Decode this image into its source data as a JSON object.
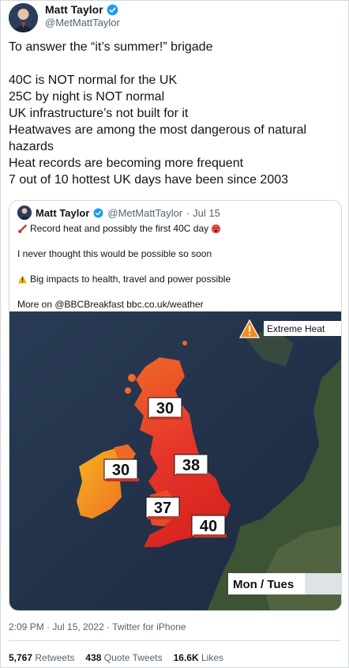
{
  "author": {
    "name": "Matt Taylor",
    "handle": "@MetMattTaylor"
  },
  "tweet": {
    "lines": [
      "To answer the “it’s summer!” brigade",
      "40C is NOT normal for the UK",
      "25C by night is NOT normal",
      "UK infrastructure’s not built for it",
      "Heatwaves are among the most dangerous of natural",
      "hazards",
      "Heat records are becoming more frequent",
      "7 out of 10 hottest UK days have been since 2003"
    ]
  },
  "quote": {
    "name": "Matt Taylor",
    "handle": "@MetMattTaylor",
    "date": "· Jul 15",
    "line1": "Record heat and possibly the first 40C day",
    "line2": "I never thought this would be possible so soon",
    "line3": "Big impacts to health, travel and power possible",
    "line4": "More on @BBCBreakfast bbc.co.uk/weather",
    "map": {
      "warning_label": "Extreme Heat",
      "day_label": "Mon / Tues",
      "temps": {
        "scotland": "30",
        "ireland": "30",
        "north_england": "38",
        "wales": "37",
        "south_england": "40"
      }
    }
  },
  "timestamp": "2:09 PM · Jul 15, 2022 · Twitter for iPhone",
  "stats": {
    "retweets_count": "5,767",
    "retweets_label": "Retweets",
    "quotes_count": "438",
    "quotes_label": "Quote Tweets",
    "likes_count": "16.6K",
    "likes_label": "Likes"
  },
  "colors": {
    "verified": "#1d9bf0",
    "secondary_text": "#536471",
    "heat_dark": "#d9251f",
    "heat_mid": "#ee5a22",
    "heat_light": "#f5a523",
    "sea": "#1f2f46"
  }
}
